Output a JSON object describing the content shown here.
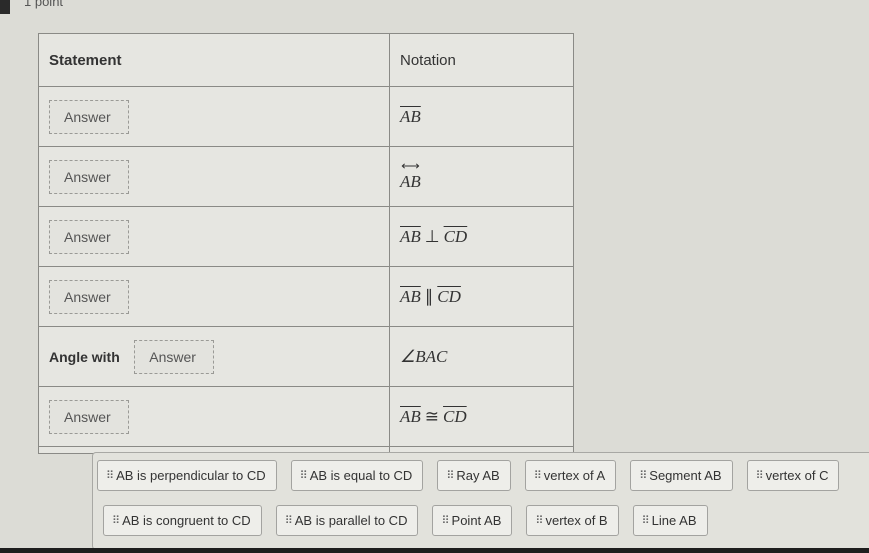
{
  "question": {
    "points_label": "1 point"
  },
  "table": {
    "headers": {
      "statement": "Statement",
      "notation": "Notation"
    },
    "rows": [
      {
        "prefix": "",
        "answer_placeholder": "Answer",
        "notation": {
          "type": "segment",
          "text": "AB"
        }
      },
      {
        "prefix": "",
        "answer_placeholder": "Answer",
        "notation": {
          "type": "line",
          "text": "AB"
        }
      },
      {
        "prefix": "",
        "answer_placeholder": "Answer",
        "notation": {
          "type": "perpendicular",
          "left": "AB",
          "op": "⊥",
          "right": "CD"
        }
      },
      {
        "prefix": "",
        "answer_placeholder": "Answer",
        "notation": {
          "type": "parallel",
          "left": "AB",
          "op": "∥",
          "right": "CD"
        }
      },
      {
        "prefix": "Angle with",
        "answer_placeholder": "Answer",
        "notation": {
          "type": "angle",
          "text": "∠BAC"
        }
      },
      {
        "prefix": "",
        "answer_placeholder": "Answer",
        "notation": {
          "type": "congruent",
          "left": "AB",
          "op": "≅",
          "right": "CD"
        }
      }
    ]
  },
  "answer_bank": {
    "grip_icon": "drag-handle-icon",
    "row1": [
      "AB is perpendicular to CD",
      "AB is equal to CD",
      "Ray AB",
      "vertex of A",
      "Segment AB",
      "vertex of C"
    ],
    "row2": [
      "AB is congruent to CD",
      "AB is parallel to CD",
      "Point AB",
      "vertex of B",
      "Line AB"
    ]
  },
  "colors": {
    "background": "#dcdcd6",
    "table_bg": "#e6e6e1",
    "border": "#8a8a86",
    "chip_bg": "#eeeeea"
  }
}
